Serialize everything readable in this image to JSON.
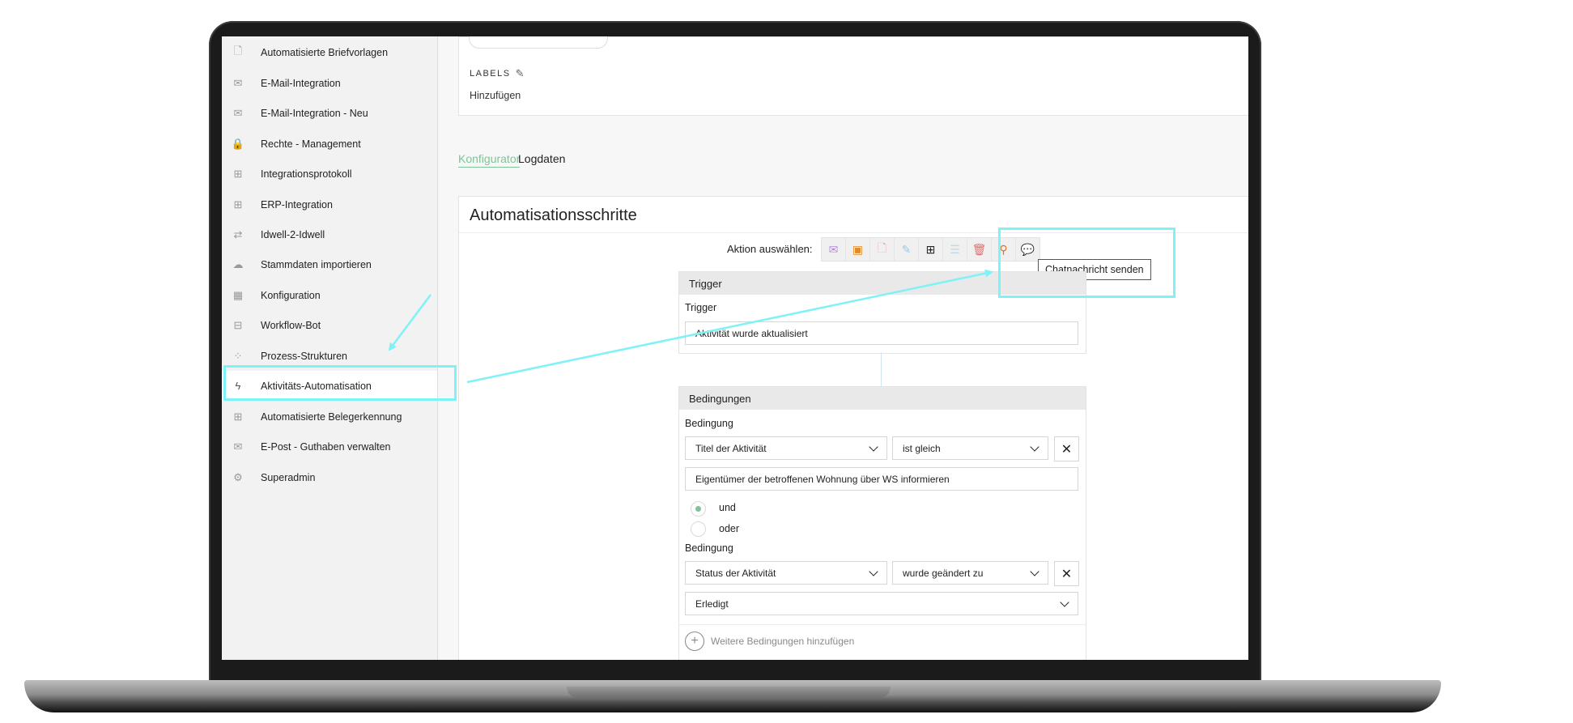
{
  "sidebar": {
    "items": [
      {
        "label": "Automatisierte Briefvorlagen",
        "icon": "document-icon"
      },
      {
        "label": "E-Mail-Integration",
        "icon": "envelope-icon"
      },
      {
        "label": "E-Mail-Integration - Neu",
        "icon": "envelope-icon"
      },
      {
        "label": "Rechte - Management",
        "icon": "lock-icon"
      },
      {
        "label": "Integrationsprotokoll",
        "icon": "network-icon"
      },
      {
        "label": "ERP-Integration",
        "icon": "network-icon"
      },
      {
        "label": "Idwell-2-Idwell",
        "icon": "swap-arrows-icon"
      },
      {
        "label": "Stammdaten importieren",
        "icon": "cloud-upload-icon"
      },
      {
        "label": "Konfiguration",
        "icon": "grid-icon"
      },
      {
        "label": "Workflow-Bot",
        "icon": "tree-icon"
      },
      {
        "label": "Prozess-Strukturen",
        "icon": "circles-icon"
      },
      {
        "label": "Aktivitäts-Automatisation",
        "icon": "lightning-icon"
      },
      {
        "label": "Automatisierte Belegerkennung",
        "icon": "network-icon"
      },
      {
        "label": "E-Post - Guthaben verwalten",
        "icon": "epost-icon"
      },
      {
        "label": "Superadmin",
        "icon": "gear-icon"
      }
    ],
    "active_index": 11
  },
  "labels_section": {
    "title": "LABELS",
    "add_label": "Hinzufügen"
  },
  "tabs": [
    {
      "label": "Konfigurator"
    },
    {
      "label": "Logdaten"
    }
  ],
  "steps": {
    "title": "Automatisationsschritte",
    "action_label": "Aktion auswählen:",
    "tooltip": "Chatnachricht senden"
  },
  "trigger": {
    "header": "Trigger",
    "label": "Trigger",
    "value": "Aktivität wurde aktualisiert"
  },
  "conditions": {
    "header": "Bedingungen",
    "condition_label": "Bedingung",
    "cond1_field": "Titel der Aktivität",
    "cond1_operator": "ist gleich",
    "cond1_value": "Eigentümer der betroffenen Wohnung über WS informieren",
    "radio_and": "und",
    "radio_or": "oder",
    "cond2_field": "Status der Aktivität",
    "cond2_operator": "wurde geändert zu",
    "cond2_value": "Erledigt",
    "add_more": "Weitere Bedingungen hinzufügen"
  },
  "colors": {
    "accent_green": "#7ec498",
    "highlight_cyan": "#7ff2f7"
  }
}
